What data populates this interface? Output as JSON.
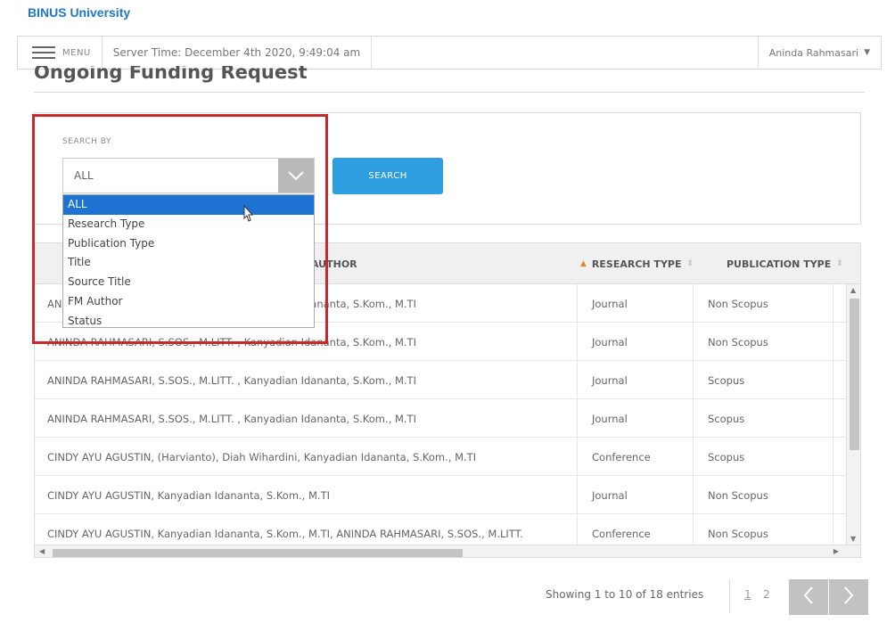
{
  "brand": "BINUS University",
  "topbar": {
    "menu_label": "MENU",
    "server_time": "Server Time: December 4th 2020, 9:49:04 am",
    "user_name": "Aninda Rahmasari",
    "user_caret": "▼"
  },
  "page": {
    "title": "Ongoing Funding Request"
  },
  "search": {
    "label": "SEARCH BY",
    "selected_value": "ALL",
    "button_label": "SEARCH",
    "options": [
      "ALL",
      "Research Type",
      "Publication Type",
      "Title",
      "Source Title",
      "FM Author",
      "Status"
    ]
  },
  "table": {
    "headers": {
      "author": "AUTHOR",
      "research_type": "RESEARCH TYPE",
      "publication_type": "PUBLICATION TYPE"
    },
    "rows": [
      {
        "author": "ANINDA RAHMASARI, S.SOS., M.LITT. , Kanyadian Idananta, S.Kom., M.TI",
        "research_type": "Journal",
        "publication_type": "Non Scopus"
      },
      {
        "author": "ANINDA RAHMASARI, S.SOS., M.LITT. , Kanyadian Idananta, S.Kom., M.TI",
        "research_type": "Journal",
        "publication_type": "Non Scopus"
      },
      {
        "author": "ANINDA RAHMASARI, S.SOS., M.LITT. , Kanyadian Idananta, S.Kom., M.TI",
        "research_type": "Journal",
        "publication_type": "Scopus"
      },
      {
        "author": "ANINDA RAHMASARI, S.SOS., M.LITT. , Kanyadian Idananta, S.Kom., M.TI",
        "research_type": "Journal",
        "publication_type": "Scopus"
      },
      {
        "author": "CINDY AYU AGUSTIN, (Harvianto), Diah Wihardini, Kanyadian Idananta, S.Kom., M.TI",
        "research_type": "Conference",
        "publication_type": "Scopus"
      },
      {
        "author": "CINDY AYU AGUSTIN, Kanyadian Idananta, S.Kom., M.TI",
        "research_type": "Journal",
        "publication_type": "Non Scopus"
      },
      {
        "author": "CINDY AYU AGUSTIN, Kanyadian Idananta, S.Kom., M.TI, ANINDA RAHMASARI, S.SOS., M.LITT.",
        "research_type": "Conference",
        "publication_type": "Non Scopus"
      }
    ]
  },
  "footer": {
    "info": "Showing 1 to 10 of 18 entries",
    "pages": [
      "1",
      "2"
    ]
  },
  "colors": {
    "brand": "#1f78c8",
    "accent": "#2f9ee0",
    "selected": "#1e73d2",
    "highlight": "#c8292c"
  },
  "icons": {
    "menu": "hamburger-icon",
    "dropdown": "chevron-down-icon",
    "prev": "chevron-left-icon",
    "next": "chevron-right-icon",
    "cursor": "mouse-pointer-icon"
  }
}
